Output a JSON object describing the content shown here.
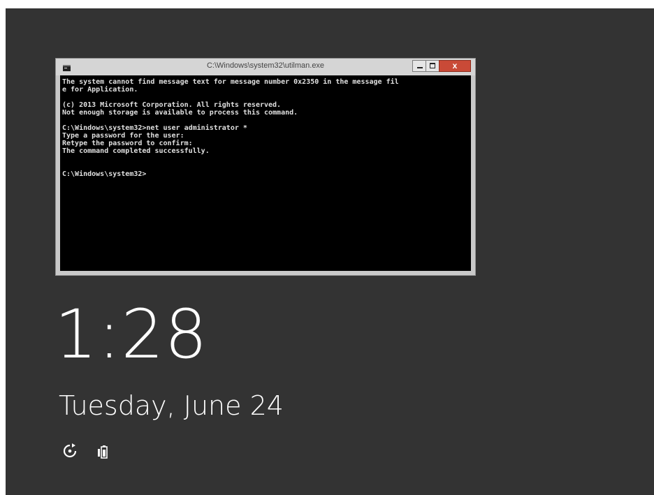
{
  "window": {
    "title": "C:\\Windows\\system32\\utilman.exe",
    "icon": "cmd-window-icon",
    "buttons": {
      "minimize_icon": "minimize-icon",
      "maximize_icon": "maximize-icon",
      "close_label": "x"
    }
  },
  "console": {
    "lines": [
      "The system cannot find message text for message number 0x2350 in the message fil",
      "e for Application.",
      "",
      "(c) 2013 Microsoft Corporation. All rights reserved.",
      "Not enough storage is available to process this command.",
      "",
      "C:\\Windows\\system32>net user administrator *",
      "Type a password for the user:",
      "Retype the password to confirm:",
      "The command completed successfully.",
      "",
      "",
      "C:\\Windows\\system32>"
    ]
  },
  "lockscreen": {
    "time": "1:28",
    "date": "Tuesday, June 24",
    "icons": [
      "ease-of-access-icon",
      "battery-icon"
    ]
  },
  "colors": {
    "lockscreen_background": "#333333",
    "console_background": "#000000",
    "console_text": "#e0e0e0",
    "close_button": "#c94a37"
  }
}
